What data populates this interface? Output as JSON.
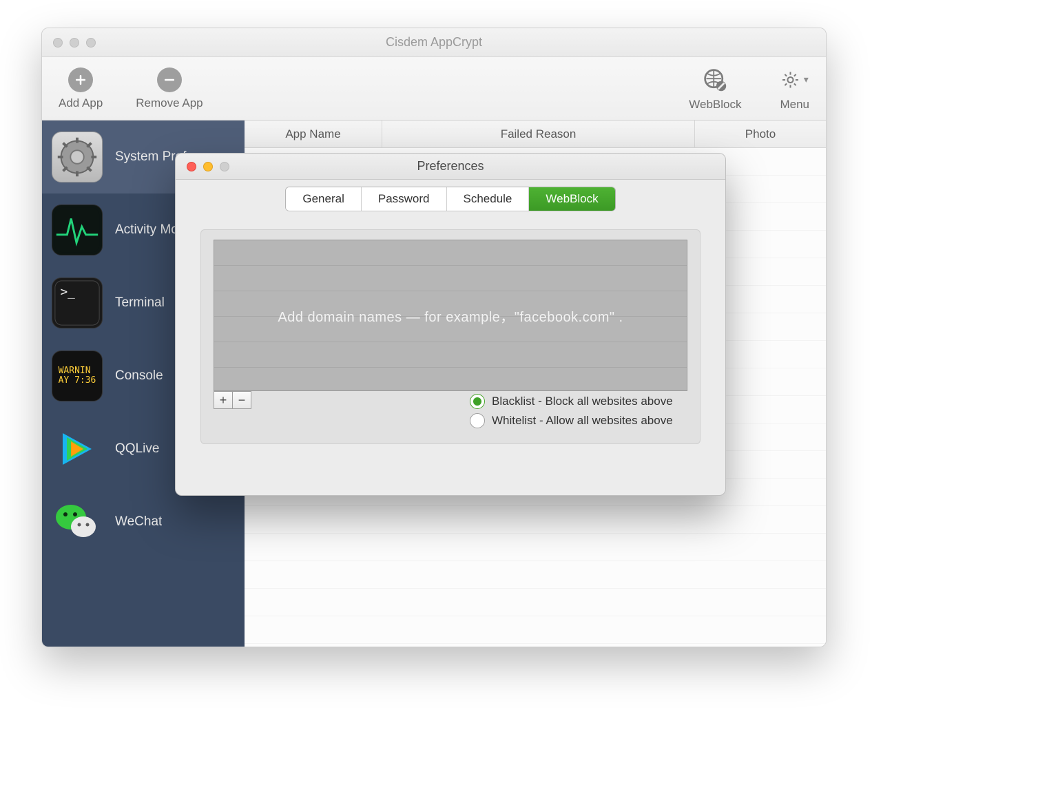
{
  "window": {
    "title": "Cisdem AppCrypt"
  },
  "toolbar": {
    "add_app_label": "Add App",
    "remove_app_label": "Remove App",
    "webblock_label": "WebBlock",
    "menu_label": "Menu"
  },
  "columns": {
    "app_name": "App Name",
    "failed_reason": "Failed Reason",
    "photo": "Photo"
  },
  "sidebar": {
    "items": [
      {
        "label": "System Preferences",
        "icon": "system-preferences",
        "selected": true
      },
      {
        "label": "Activity Monitor",
        "icon": "activity-monitor",
        "selected": false
      },
      {
        "label": "Terminal",
        "icon": "terminal",
        "selected": false
      },
      {
        "label": "Console",
        "icon": "console",
        "selected": false,
        "console_text": "WARNIN\nAY 7:36"
      },
      {
        "label": "QQLive",
        "icon": "qqlive",
        "selected": false
      },
      {
        "label": "WeChat",
        "icon": "wechat",
        "selected": false
      }
    ]
  },
  "preferences": {
    "title": "Preferences",
    "tabs": [
      {
        "label": "General",
        "active": false
      },
      {
        "label": "Password",
        "active": false
      },
      {
        "label": "Schedule",
        "active": false
      },
      {
        "label": "WebBlock",
        "active": true
      }
    ],
    "domain_placeholder": "Add domain names — for example，\"facebook.com\" .",
    "blacklist_label": "Blacklist - Block all websites above",
    "whitelist_label": "Whitelist - Allow all websites above",
    "selected_mode": "blacklist"
  }
}
